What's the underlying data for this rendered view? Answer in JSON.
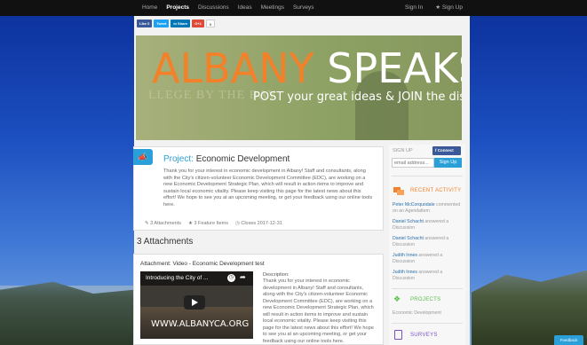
{
  "nav": {
    "items": [
      "Home",
      "Projects",
      "Discussions",
      "Ideas",
      "Meetings",
      "Surveys"
    ],
    "active": "Projects",
    "sign_in": "Sign In",
    "sign_up": "★ Sign Up"
  },
  "share": {
    "like": "Like 0",
    "tweet": "Tweet",
    "linkedin": "in Share",
    "gplus": "G+1",
    "gplus_count": "0"
  },
  "banner": {
    "title_part1": "ALBANY",
    "title_part2": " SPEAKS!",
    "subtitle": "POST your great ideas & JOIN the discussion",
    "building_text": "LLEGE BY THE BAY"
  },
  "project": {
    "label": "Project:",
    "title": "Economic Development",
    "description": "Thank you for your interest in economic development in Albany! Staff and consultants, along with the City's citizen-volunteer Economic Development Committee (EDC), are working on a new Economic Development Strategic Plan, which will result in action items to improve and sustain local economic vitality. Please keep visiting this page for the latest news about this effort! We hope to see you at an upcoming meeting, or get your feedback using our online tools here.",
    "attachments_meta": "3 Attachments",
    "features_meta": "3 Feature Items",
    "closes_meta": "Closes 2017-12-31"
  },
  "attachments": {
    "heading": "3 Attachments",
    "item_title": "Attachment: Video - Economic Development test",
    "video_title": "Introducing the City of ...",
    "video_url": "WWW.ALBANYCA.ORG",
    "desc_label": "Description:",
    "desc_text": "Thank you for your interest in economic development in Albany! Staff and consultants, along with the City's citizen-volunteer Economic Development Committee (EDC), are working on a new Economic Development Strategic Plan, which will result in action items to improve and sustain local economic vitality. Please keep visiting this page for the latest news about this effort! We hope to see you at an upcoming meeting, or get your feedback using our online tools here."
  },
  "sidebar": {
    "signup_label": "SIGN UP",
    "fb_connect": "f  Connect",
    "email_placeholder": "email address...",
    "signup_button": "Sign Up",
    "recent_title": "RECENT ACTIVITY",
    "activity": [
      {
        "who": "Peter McCorquodale",
        "what": " commented on an Agendaltem"
      },
      {
        "who": "Daniel Schacht",
        "what": " answered a Discussion"
      },
      {
        "who": "Daniel Schacht",
        "what": " answered a Discussion"
      },
      {
        "who": "Judith Innes",
        "what": " answered a Discussion"
      },
      {
        "who": "Judith Innes",
        "what": " answered a Discussion"
      }
    ],
    "projects_title": "PROJECTS",
    "projects_item": "Economic Development",
    "surveys_title": "SURVEYS"
  },
  "feedback": "Feedback",
  "colors": {
    "accent_orange": "#f2812a",
    "accent_blue": "#2a9fd8",
    "projects_green": "#5bbf4a",
    "surveys_purple": "#7b4fc9"
  }
}
